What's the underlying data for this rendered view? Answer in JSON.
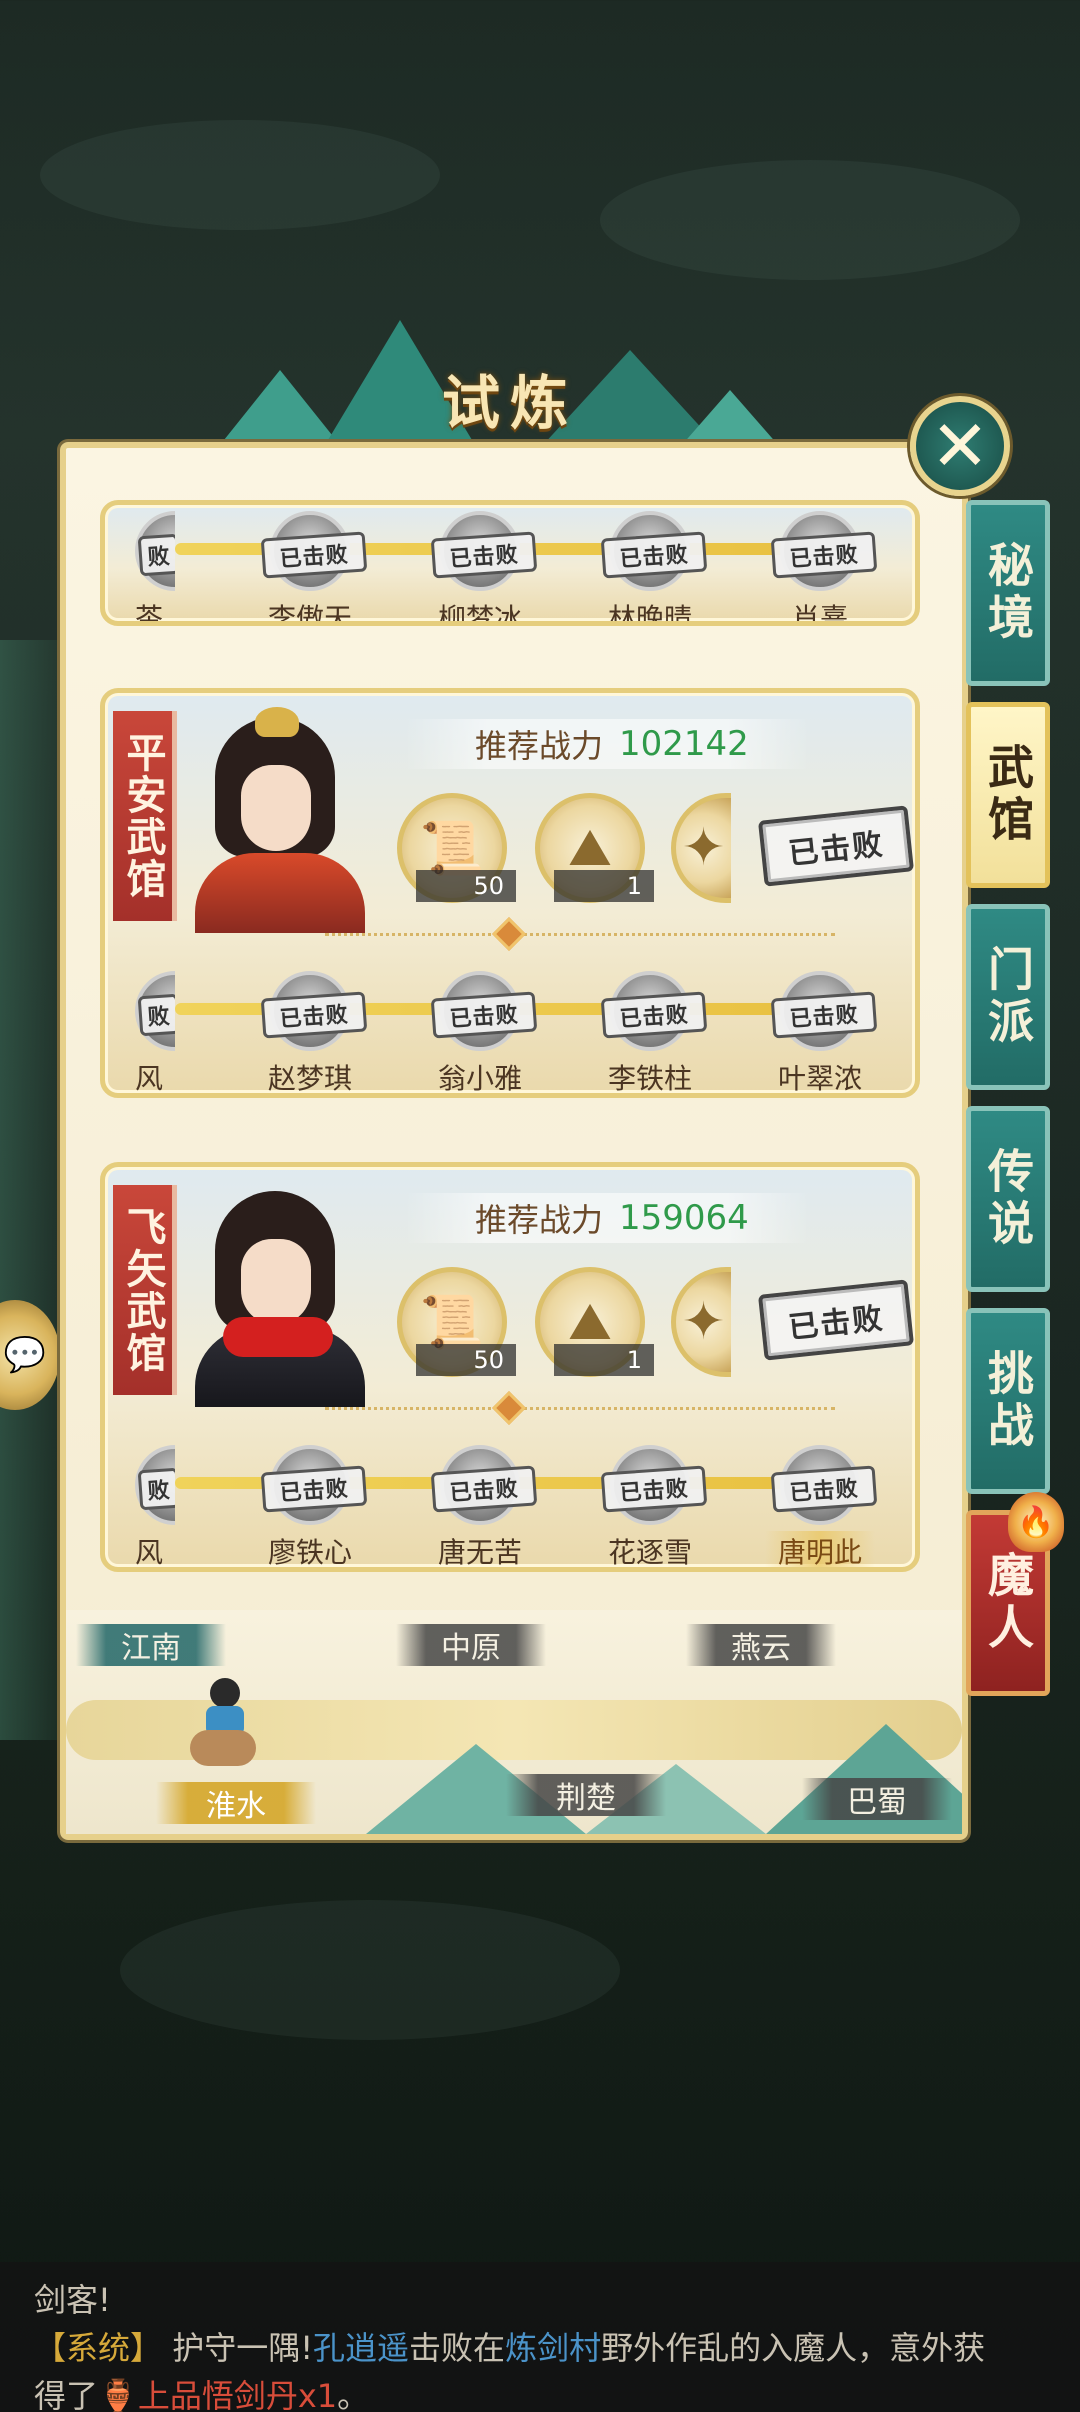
{
  "header": {
    "title": "试炼"
  },
  "close": {
    "icon": "close-x-icon",
    "glyph": "✕"
  },
  "partial_card": {
    "opponents": [
      {
        "name": "茶",
        "status": "败",
        "cut": true
      },
      {
        "name": "李傲天",
        "status": "已击败"
      },
      {
        "name": "柳梦冰",
        "status": "已击败"
      },
      {
        "name": "林晚晴",
        "status": "已击败"
      },
      {
        "name": "肖熹",
        "status": "已击败"
      }
    ]
  },
  "gyms": [
    {
      "name": "平安武馆",
      "power_label": "推荐战力",
      "power_value": "102142",
      "rewards": [
        {
          "icon": "scroll-icon",
          "glyph": "📜",
          "count": "50"
        },
        {
          "icon": "gold-ore-icon",
          "glyph": "⛰",
          "count": "1"
        }
      ],
      "defeated_label": "已击败",
      "opponents": [
        {
          "name": "风",
          "status": "败",
          "cut": true
        },
        {
          "name": "赵梦琪",
          "status": "已击败"
        },
        {
          "name": "翁小雅",
          "status": "已击败"
        },
        {
          "name": "李铁柱",
          "status": "已击败"
        },
        {
          "name": "叶翠浓",
          "status": "已击败"
        }
      ]
    },
    {
      "name": "飞矢武馆",
      "power_label": "推荐战力",
      "power_value": "159064",
      "rewards": [
        {
          "icon": "scroll-icon",
          "glyph": "📜",
          "count": "50"
        },
        {
          "icon": "gold-ore-icon",
          "glyph": "⛰",
          "count": "1"
        }
      ],
      "defeated_label": "已击败",
      "opponents": [
        {
          "name": "风",
          "status": "败",
          "cut": true
        },
        {
          "name": "廖铁心",
          "status": "已击败"
        },
        {
          "name": "唐无苦",
          "status": "已击败"
        },
        {
          "name": "花逐雪",
          "status": "已击败"
        },
        {
          "name": "唐明此",
          "status": "已击败",
          "gold": true
        }
      ]
    }
  ],
  "side_tabs": [
    {
      "label": "秘境",
      "style": "teal"
    },
    {
      "label": "武馆",
      "style": "active"
    },
    {
      "label": "门派",
      "style": "teal"
    },
    {
      "label": "传说",
      "style": "teal"
    },
    {
      "label": "挑战",
      "style": "teal"
    },
    {
      "label": "魔人",
      "style": "red"
    }
  ],
  "map": {
    "regions_top": [
      {
        "label": "江南",
        "style": "teal"
      },
      {
        "label": "中原",
        "style": "gray"
      },
      {
        "label": "燕云",
        "style": "gray"
      }
    ],
    "regions_bottom": [
      {
        "label": "淮水",
        "style": "gold"
      },
      {
        "label": "荆楚",
        "style": "gray"
      },
      {
        "label": "巴蜀",
        "style": "gray"
      }
    ]
  },
  "chat": {
    "line1": "剑客!",
    "sys_tag": "【系统】",
    "t1": " 护守一隅!",
    "player": "孔逍遥",
    "t2": "击败在",
    "place": "炼剑村",
    "t3": "野外作乱的入魔人，意外获",
    "t4": "得了",
    "item": "上品悟剑丹x1",
    "t5": "。"
  },
  "colors": {
    "accent_gold": "#e6d08b",
    "power_green": "#2f9a4a",
    "tab_teal": "#2f8a84",
    "banner_red": "#c9473a"
  }
}
